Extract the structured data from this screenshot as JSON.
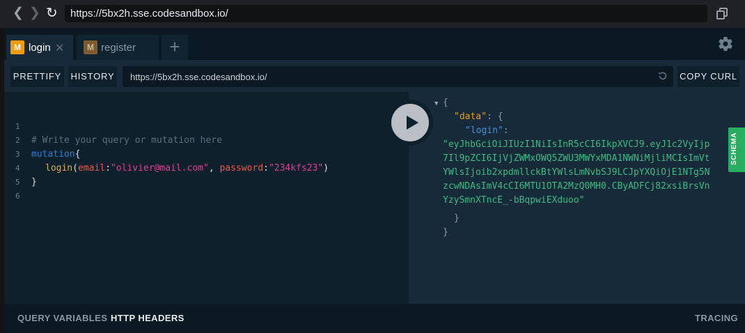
{
  "browser": {
    "url": "https://5bx2h.sse.codesandbox.io/"
  },
  "tabs": [
    {
      "badge": "M",
      "label": "login",
      "close": "✕",
      "active": true
    },
    {
      "badge": "M",
      "label": "register",
      "active": false
    }
  ],
  "add_tab_label": "+",
  "toolbar": {
    "prettify_label": "PRETTIFY",
    "history_label": "HISTORY",
    "endpoint": "https://5bx2h.sse.codesandbox.io/",
    "copy_curl_label": "COPY CURL"
  },
  "editor": {
    "line_numbers": [
      "1",
      "2",
      "3",
      "4",
      "5",
      "6"
    ],
    "comment": "# Write your query or mutation here",
    "mutation_keyword": "mutation",
    "open_brace": "{",
    "field_name": "login",
    "open_paren": "(",
    "arg1_name": "email",
    "colon": ":",
    "arg1_value": "\"olivier@mail.com\"",
    "comma": ", ",
    "arg2_name": "password",
    "arg2_value": "\"234kfs23\"",
    "close_paren": ")",
    "close_brace": "}"
  },
  "result": {
    "open_brace": "{",
    "data_key": "\"data\"",
    "colon_open": ": {",
    "login_key": "\"login\"",
    "colon": ":",
    "token_lines": [
      "\"eyJhbGciOiJIUzI1NiIsInR5cCI6IkpXVCJ9.eyJ1c2VyIjp",
      "7Il9pZCI6IjVjZWMxOWQ5ZWU3MWYxMDA1NWNiMjliMCIsImVt",
      "YWlsIjoib2xpdmllckBtYWlsLmNvbSJ9LCJpYXQiOjE1NTg5N",
      "zcwNDAsImV4cCI6MTU1OTA2MzQ0MH0.CByADFCj82xsiBrsVn",
      "YzySmnXTncE_-bBqpwiEXduoo\""
    ],
    "inner_close": "}",
    "outer_close": "}"
  },
  "schema_label": "SCHEMA",
  "bottom": {
    "query_variables_label": "QUERY VARIABLES",
    "http_headers_label": "HTTP HEADERS",
    "tracing_label": "TRACING"
  }
}
